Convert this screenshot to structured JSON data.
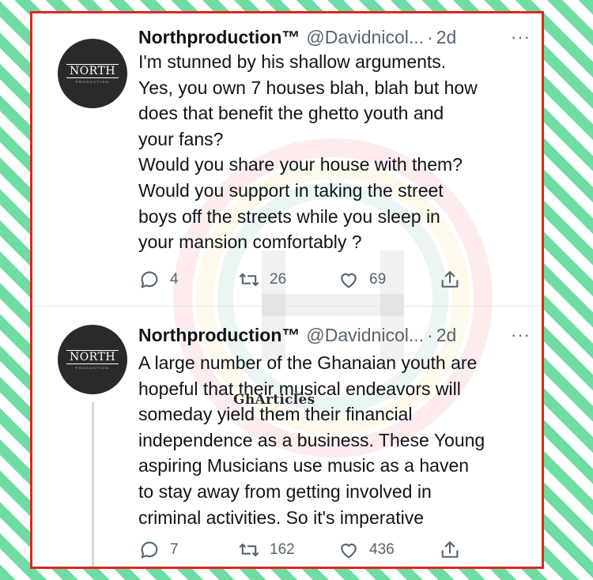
{
  "tweets": [
    {
      "avatar": {
        "logo": "NORTH",
        "sub": "PRODUCTION"
      },
      "name": "Northproduction™",
      "handle": "@Davidnicol...",
      "separator": "·",
      "time": "2d",
      "more": "···",
      "text": "I'm stunned by his shallow arguments.\nYes, you own 7 houses blah, blah but how\ndoes that benefit the ghetto youth and\nyour fans?\nWould you share your house with them?\nWould you support in taking the street\nboys off the streets while you sleep in\nyour mansion comfortably ?",
      "replies": "4",
      "retweets": "26",
      "likes": "69"
    },
    {
      "avatar": {
        "logo": "NORTH",
        "sub": "PRODUCTION"
      },
      "name": "Northproduction™",
      "handle": "@Davidnicol...",
      "separator": "·",
      "time": "2d",
      "more": "···",
      "text": "A large number of the Ghanaian youth are\nhopeful that their musical endeavors will\nsomeday yield them their financial\nindependence as a business. These Young\naspiring Musicians use music as a haven\nto stay away from getting involved in\ncriminal activities. So it's imperative",
      "replies": "7",
      "retweets": "162",
      "likes": "436"
    }
  ],
  "watermark": {
    "text": "GhArticles"
  },
  "colors": {
    "stripe": "#6fdca3",
    "frame": "#d8291f",
    "icon": "#536471"
  },
  "icons": [
    "reply-icon",
    "retweet-icon",
    "like-icon",
    "share-icon",
    "more-icon"
  ]
}
